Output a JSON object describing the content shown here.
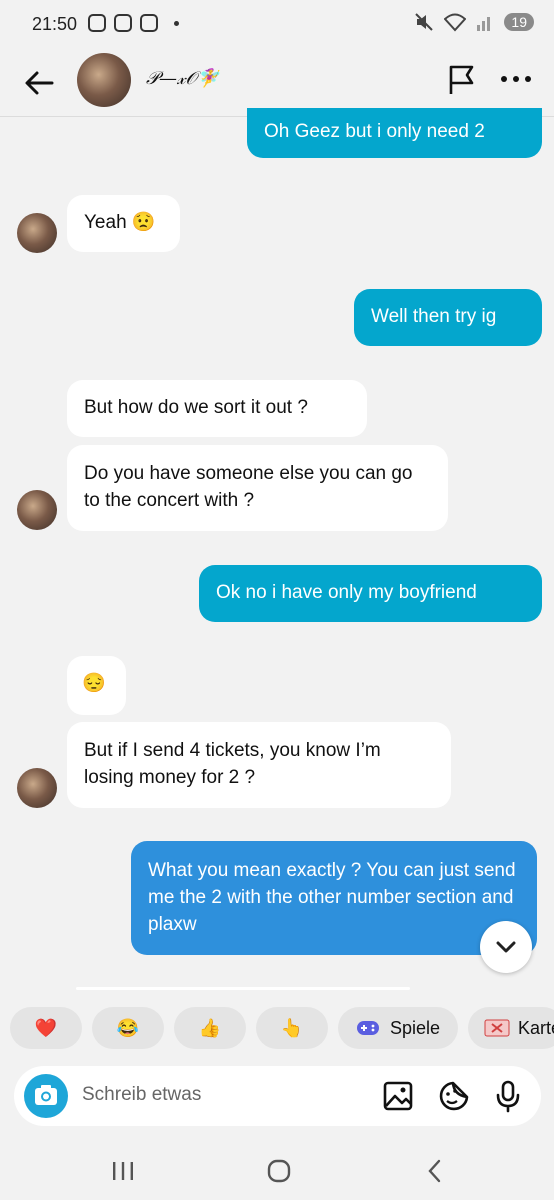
{
  "status_bar": {
    "time": "21:50",
    "battery": "19"
  },
  "header": {
    "contact_name": "𝒫—𝓍𝒪🧚‍♀️"
  },
  "messages": [
    {
      "from": "me",
      "text": "Oh Geez but i only need 2"
    },
    {
      "from": "them",
      "text": "Yeah",
      "emoji": "😟"
    },
    {
      "from": "me",
      "text": "Well then try ig"
    },
    {
      "from": "them",
      "text": "But how do we sort it out ?"
    },
    {
      "from": "them",
      "text": "Do you have someone else you can go to the concert with ?"
    },
    {
      "from": "me",
      "text": "Ok no i have only my boyfriend"
    },
    {
      "from": "them",
      "text": "",
      "emoji": "😔"
    },
    {
      "from": "them",
      "text": "But if I send 4 tickets, you know I’m losing money for 2 ?"
    },
    {
      "from": "me",
      "text": "What you mean exactly ? You can just send me the 2 with the other number section and plaxw"
    }
  ],
  "quick_reactions": [
    "❤️",
    "😂",
    "👍",
    "👆"
  ],
  "chips": {
    "games": "Spiele",
    "cards": "Karte"
  },
  "input": {
    "placeholder": "Schreib etwas"
  },
  "icons": {
    "back": "arrow-left-icon",
    "flag": "flag-icon",
    "more": "more-dots-icon",
    "camera": "camera-icon",
    "gallery": "image-icon",
    "sticker": "sticker-icon",
    "mic": "microphone-icon"
  },
  "colors": {
    "outgoing": "#04a6cd",
    "outgoing_selected": "#2e90dc",
    "incoming": "#ffffff",
    "background": "#f2f2f2"
  }
}
